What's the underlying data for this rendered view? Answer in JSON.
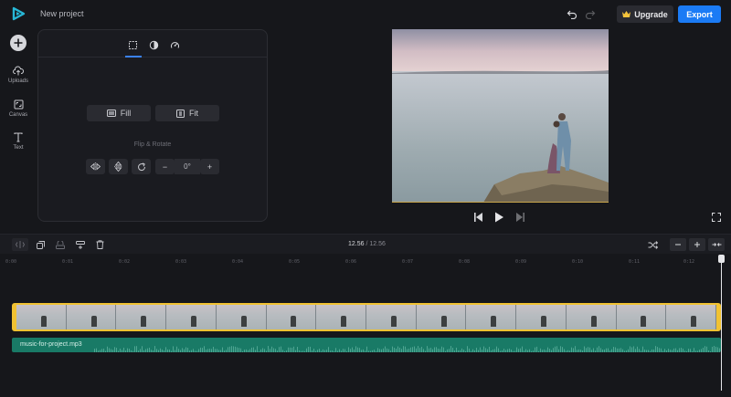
{
  "header": {
    "project_name": "New project",
    "upgrade_label": "Upgrade",
    "export_label": "Export",
    "colors": {
      "accent": "#1b7bf5",
      "crown": "#f5c33b"
    }
  },
  "sidebar": {
    "items": [
      {
        "label": "Uploads",
        "icon": "upload-cloud-icon"
      },
      {
        "label": "Canvas",
        "icon": "canvas-icon"
      },
      {
        "label": "Text",
        "icon": "text-icon"
      }
    ]
  },
  "panel": {
    "tabs": [
      {
        "icon": "crop-icon",
        "active": true
      },
      {
        "icon": "contrast-icon",
        "active": false
      },
      {
        "icon": "speed-icon",
        "active": false
      }
    ],
    "fill_label": "Fill",
    "fit_label": "Fit",
    "flip_rotate_label": "Flip & Rotate",
    "rotation_value": "0°",
    "minus_label": "−",
    "plus_label": "+"
  },
  "timeline": {
    "current_time": "12.56",
    "separator": "/",
    "duration": "12.56",
    "ticks": [
      "0:00",
      "0:01",
      "0:02",
      "0:03",
      "0:04",
      "0:05",
      "0:06",
      "0:07",
      "0:08",
      "0:09",
      "0:10",
      "0:11",
      "0:12"
    ],
    "audio_track_name": "music-for-project.mp3",
    "colors": {
      "video_border": "#f1c232",
      "audio_track": "#197a66"
    }
  }
}
